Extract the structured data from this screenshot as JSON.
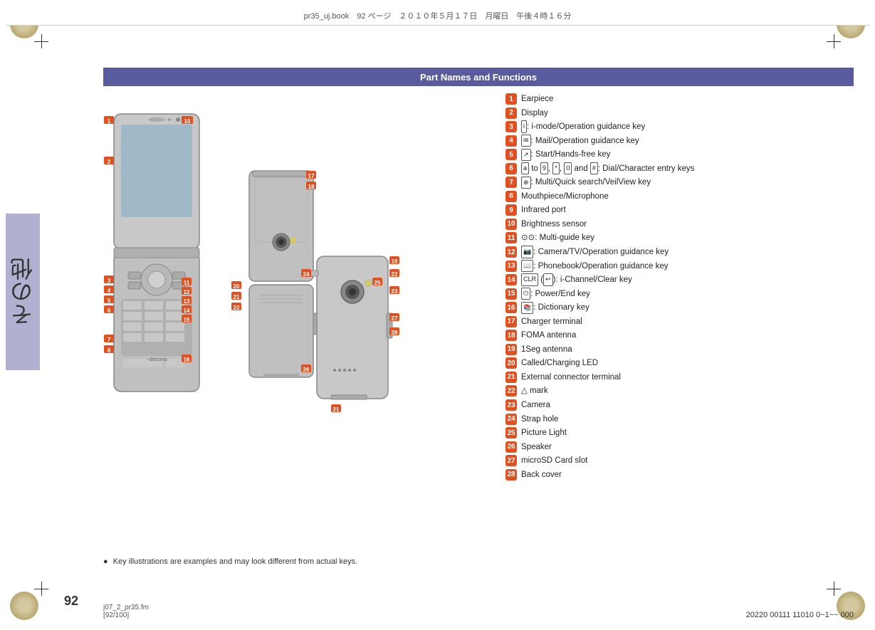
{
  "page": {
    "header_text": "pr35_uj.book　92 ページ　２０１０年５月１７日　月曜日　午後４時１６分",
    "title": "Part Names and Functions",
    "page_number": "92",
    "footer_file": "j07_2_pr35.fm",
    "footer_pages": "[92/100]",
    "footer_code": "20220  00111  11010  0~1~~ 000",
    "footnote": "Key illustrations are examples and may look different from actual keys.",
    "tab_text": "その他"
  },
  "parts": [
    {
      "num": "1",
      "text": "Earpiece"
    },
    {
      "num": "2",
      "text": "Display"
    },
    {
      "num": "3",
      "text": ": i-mode/Operation guidance key"
    },
    {
      "num": "4",
      "text": ": Mail/Operation guidance key"
    },
    {
      "num": "5",
      "text": ": Start/Hands-free key"
    },
    {
      "num": "6",
      "text": "to  ,  ,   and  : Dial/Character entry keys"
    },
    {
      "num": "7",
      "text": ": Multi/Quick search/VeilView key"
    },
    {
      "num": "8",
      "text": "Mouthpiece/Microphone"
    },
    {
      "num": "9",
      "text": "Infrared port"
    },
    {
      "num": "10",
      "text": "Brightness sensor"
    },
    {
      "num": "11",
      "text": ": Multi-guide key"
    },
    {
      "num": "12",
      "text": ": Camera/TV/Operation guidance key"
    },
    {
      "num": "13",
      "text": ": Phonebook/Operation guidance key"
    },
    {
      "num": "14",
      "text": "( ): i-Channel/Clear key"
    },
    {
      "num": "15",
      "text": ": Power/End key"
    },
    {
      "num": "16",
      "text": ": Dictionary key"
    },
    {
      "num": "17",
      "text": "Charger terminal"
    },
    {
      "num": "18",
      "text": "FOMA antenna"
    },
    {
      "num": "19",
      "text": "1Seg antenna"
    },
    {
      "num": "20",
      "text": "Called/Charging LED"
    },
    {
      "num": "21",
      "text": "External connector terminal"
    },
    {
      "num": "22",
      "text": "mark"
    },
    {
      "num": "23",
      "text": "Camera"
    },
    {
      "num": "24",
      "text": "Strap hole"
    },
    {
      "num": "25",
      "text": "Picture Light"
    },
    {
      "num": "26",
      "text": "Speaker"
    },
    {
      "num": "27",
      "text": "microSD Card slot"
    },
    {
      "num": "28",
      "text": "Back cover"
    }
  ]
}
